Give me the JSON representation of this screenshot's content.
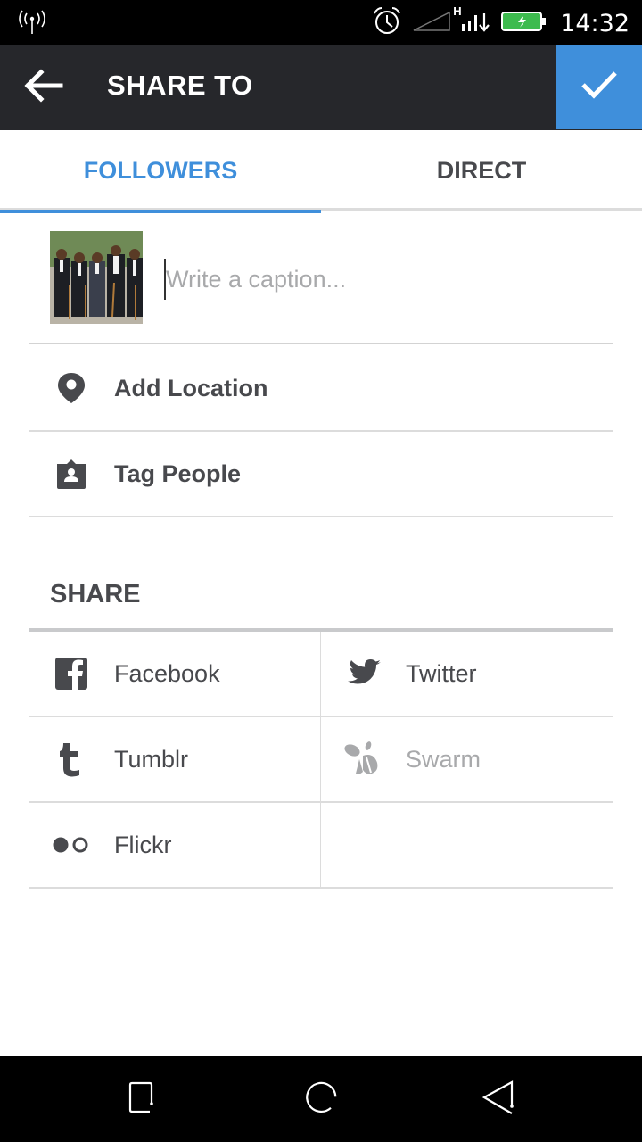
{
  "status_bar": {
    "time": "14:32",
    "network_type": "H",
    "icons": [
      "wireless-hotspot-icon",
      "alarm-icon",
      "signal-empty-icon",
      "signal-icon",
      "battery-charging-icon"
    ]
  },
  "app_bar": {
    "title": "SHARE TO",
    "back_icon": "arrow-left-icon",
    "confirm_icon": "check-icon"
  },
  "tabs": [
    {
      "label": "FOLLOWERS",
      "active": true
    },
    {
      "label": "DIRECT",
      "active": false
    }
  ],
  "caption": {
    "placeholder": "Write a caption...",
    "value": "",
    "thumbnail": "Group photo of five men in suits holding canes"
  },
  "options": [
    {
      "label": "Add Location",
      "icon": "location-pin-icon"
    },
    {
      "label": "Tag People",
      "icon": "tag-person-icon"
    }
  ],
  "share": {
    "header": "SHARE",
    "services": [
      {
        "label": "Facebook",
        "icon": "facebook-icon",
        "enabled": true
      },
      {
        "label": "Twitter",
        "icon": "twitter-icon",
        "enabled": true
      },
      {
        "label": "Tumblr",
        "icon": "tumblr-icon",
        "enabled": true
      },
      {
        "label": "Swarm",
        "icon": "swarm-icon",
        "enabled": false
      },
      {
        "label": "Flickr",
        "icon": "flickr-icon",
        "enabled": true
      }
    ]
  },
  "nav_bar": {
    "buttons": [
      "recent-apps",
      "home",
      "back"
    ]
  },
  "colors": {
    "accent": "#3f8fdb",
    "app_bar_bg": "#26272b",
    "text_dark": "#48494d",
    "text_disabled": "#a8a9ab",
    "battery_green": "#3dbb4e"
  }
}
